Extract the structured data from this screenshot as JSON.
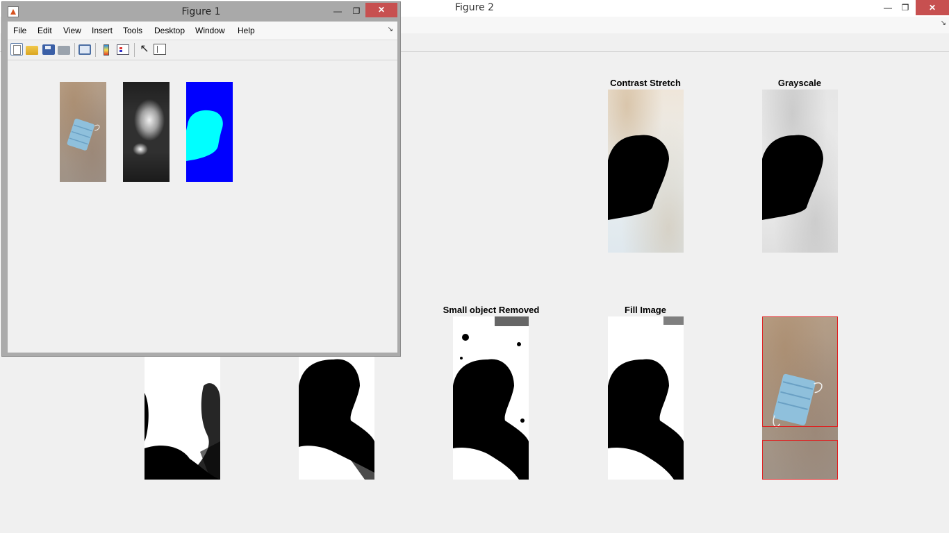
{
  "figure2": {
    "title": "Figure 2",
    "panels": {
      "contrast_stretch": {
        "title": "Contrast Stretch"
      },
      "grayscale": {
        "title": "Grayscale"
      },
      "small_object_removed": {
        "title": "Small object Removed"
      },
      "fill_image": {
        "title": "Fill Image"
      }
    }
  },
  "figure1": {
    "title": "Figure 1",
    "menu": [
      "File",
      "Edit",
      "View",
      "Insert",
      "Tools",
      "Desktop",
      "Window",
      "Help"
    ]
  },
  "toolbar_icons": [
    "new-figure-icon",
    "open-file-icon",
    "save-icon",
    "print-icon",
    "print-figure-icon",
    "colorbar-icon",
    "legend-icon",
    "pointer-icon",
    "plot-browser-icon"
  ],
  "colors": {
    "close_button": "#c75050",
    "segmentation_blue": "#0000ff",
    "segmentation_cyan": "#00ffff",
    "bounding_box": "#e02020"
  }
}
